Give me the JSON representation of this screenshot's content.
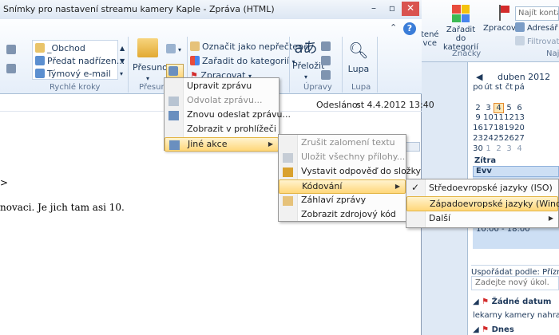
{
  "window": {
    "title": "Snímky pro nastavení streamu kamery Kaple - Zpráva (HTML)",
    "help_label": "?",
    "collapse_label": "⌃"
  },
  "ribbon": {
    "quick_steps": [
      "_Obchod",
      "Předat nadřízen...",
      "Týmový e-mail"
    ],
    "group_quick_steps": "Rychlé kroky",
    "move_label": "Přesunout",
    "group_move": "Přesuno",
    "mark_unread": "Označit jako nepřečtené",
    "categorize": "Zařadit do kategorií",
    "followup": "Zpracovat",
    "translate": "Přeložit",
    "group_edit": "Úpravy",
    "zoom": "Lupa",
    "group_zoom": "Lupa"
  },
  "bg_ribbon": {
    "item_tene_line1": "tené",
    "item_tene_line2": "vce",
    "categorize_line1": "Zařadit do",
    "categorize_line2": "kategorií",
    "followup": "Zpracovat",
    "group_tags": "Značky",
    "group_find": "Najít",
    "search_placeholder": "Najít kontakt",
    "address_book": "Adresář",
    "filter": "Filtrovat"
  },
  "message": {
    "sent_label": "Odesláno:",
    "sent_value": "st 4.4.2012 13:40",
    "body_gt": ">",
    "body_text": "novaci. Je jich tam asi 10."
  },
  "menu_actions": {
    "items": [
      {
        "label": "Upravit zprávu",
        "disabled": false
      },
      {
        "label": "Odvolat zprávu...",
        "disabled": true
      },
      {
        "label": "Znovu odeslat zprávu...",
        "disabled": false
      },
      {
        "label": "Zobrazit v prohlížeči",
        "disabled": false
      },
      {
        "label": "Jiné akce",
        "disabled": false
      }
    ]
  },
  "menu_other": {
    "items": [
      {
        "label": "Zrušit zalomení textu",
        "disabled": true
      },
      {
        "label": "Uložit všechny přílohy...",
        "disabled": true
      },
      {
        "label": "Vystavit odpověď do složky",
        "disabled": false
      },
      {
        "label": "Kódování",
        "disabled": false
      },
      {
        "label": "Záhlaví zprávy",
        "disabled": false
      },
      {
        "label": "Zobrazit zdrojový kód",
        "disabled": false
      }
    ]
  },
  "menu_encoding": {
    "items": [
      {
        "label": "Středoevropské jazyky (ISO)",
        "checked": true
      },
      {
        "label": "Západoevropské jazyky (Windows)",
        "checked": false
      },
      {
        "label": "Další",
        "checked": false
      }
    ]
  },
  "calendar": {
    "month": "duben 2012",
    "weekdays": [
      "po",
      "út",
      "st",
      "čt",
      "pá"
    ],
    "weeks": [
      [
        "",
        "",
        "",
        "",
        ""
      ],
      [
        "2",
        "3",
        "4",
        "5",
        "6"
      ],
      [
        "9",
        "10",
        "11",
        "12",
        "13"
      ],
      [
        "16",
        "17",
        "18",
        "19",
        "20"
      ],
      [
        "23",
        "24",
        "25",
        "26",
        "27"
      ],
      [
        "30",
        "1",
        "2",
        "3",
        "4"
      ]
    ],
    "today": "4"
  },
  "todo": {
    "tomorrow": "Zítra",
    "event_title": "Evv",
    "event_time": "10:00 - 18:00",
    "arrange_by": "Uspořádat podle: Příznak:",
    "new_task_placeholder": "Zadejte nový úkol.",
    "no_date": "Žádné datum",
    "task_item": "lekarny kamery nahravani",
    "today": "Dnes"
  },
  "colors": {
    "accent": "#3b7dd8",
    "highlight": "#ffd77a",
    "ribbon_bg": "#e5eef9"
  }
}
